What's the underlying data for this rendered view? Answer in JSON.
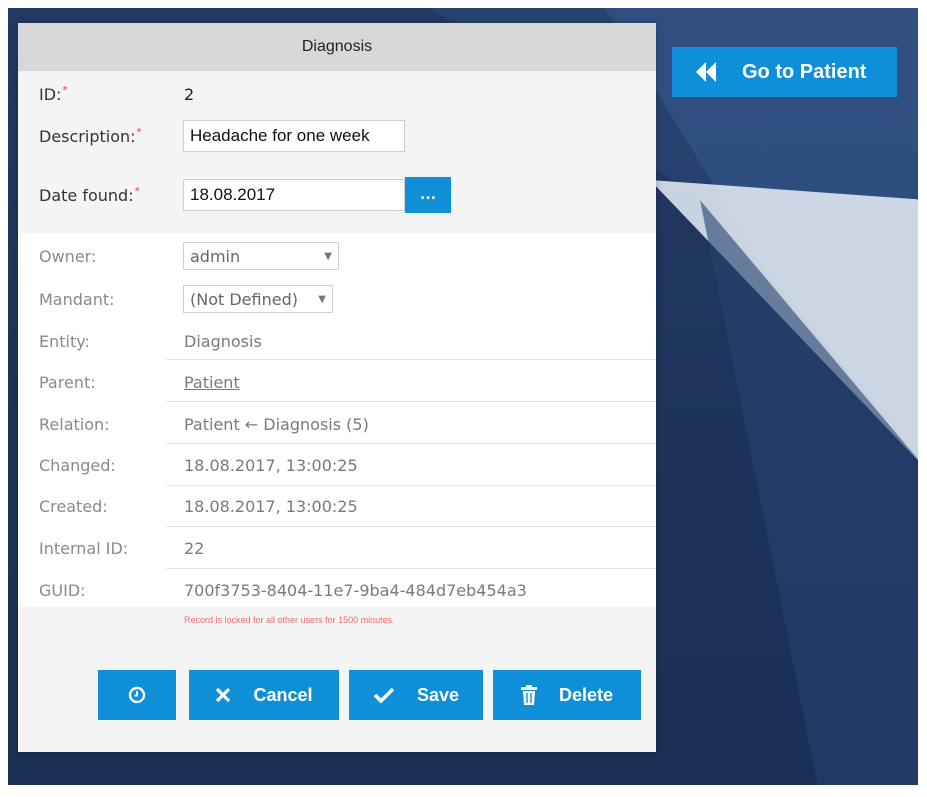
{
  "panel": {
    "title": "Diagnosis"
  },
  "goto": {
    "label": "Go to Patient",
    "icon": "double-chevron-left-icon"
  },
  "fields": {
    "id": {
      "label": "ID:",
      "value": "2"
    },
    "description": {
      "label": "Description:",
      "value": "Headache for one week"
    },
    "date_found": {
      "label": "Date found:",
      "value": "18.08.2017",
      "picker_label": "..."
    },
    "owner": {
      "label": "Owner:",
      "value": "admin"
    },
    "mandant": {
      "label": "Mandant:",
      "value": "(Not Defined)"
    },
    "entity": {
      "label": "Entity:",
      "value": "Diagnosis"
    },
    "parent": {
      "label": "Parent:",
      "value": "Patient"
    },
    "relation": {
      "label": "Relation:",
      "value": "Patient ← Diagnosis (5)"
    },
    "changed": {
      "label": "Changed:",
      "value": "18.08.2017, 13:00:25"
    },
    "created": {
      "label": "Created:",
      "value": "18.08.2017, 13:00:25"
    },
    "internal_id": {
      "label": "Internal ID:",
      "value": "22"
    },
    "guid": {
      "label": "GUID:",
      "value": "700f3753-8404-11e7-9ba4-484d7eb454a3"
    }
  },
  "lock_message": "Record is locked for all other users for 1500 minutes.",
  "buttons": {
    "history": {
      "label": "",
      "icon": "clock-icon"
    },
    "cancel": {
      "label": "Cancel",
      "icon": "x-icon"
    },
    "save": {
      "label": "Save",
      "icon": "check-icon"
    },
    "delete": {
      "label": "Delete",
      "icon": "trash-icon"
    }
  },
  "colors": {
    "accent": "#0f8fd8",
    "background": "#1d335a",
    "lock_message": "#f06a6a"
  }
}
